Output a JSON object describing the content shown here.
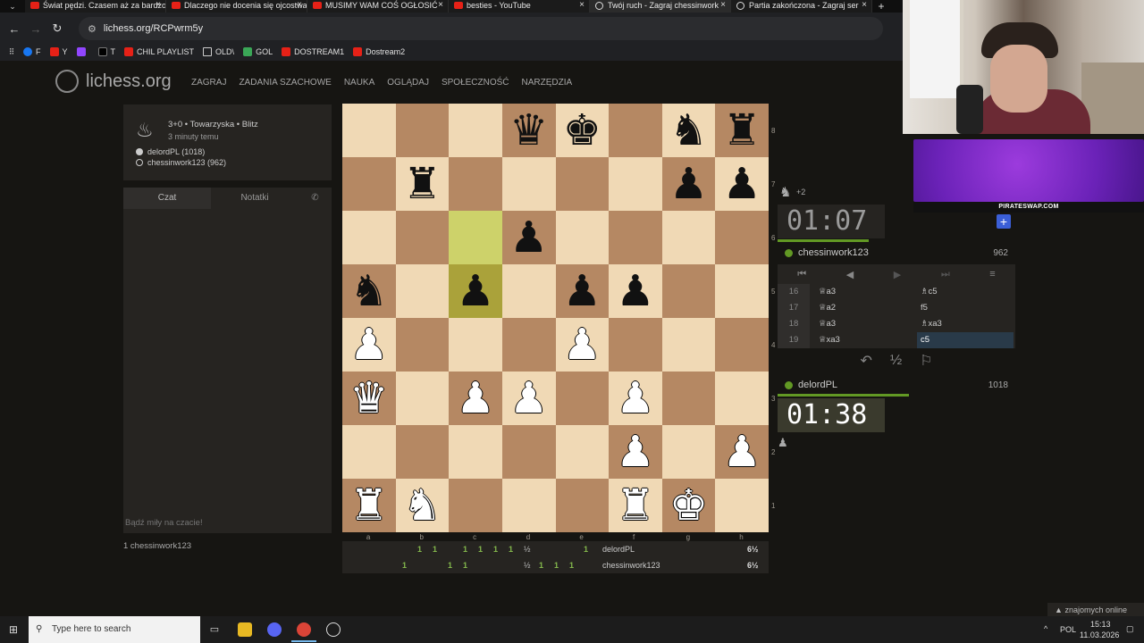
{
  "browser": {
    "tabs": [
      {
        "title": "Świat pędzi. Czasem aż za bardzo",
        "favicon": "youtube-icon",
        "active": false
      },
      {
        "title": "Dlaczego nie docenia się ojcostwa",
        "favicon": "youtube-icon",
        "active": false
      },
      {
        "title": "MUSIMY WAM COŚ OGŁOSIĆ",
        "favicon": "youtube-icon",
        "active": false
      },
      {
        "title": "besties - YouTube",
        "favicon": "youtube-icon",
        "active": false
      },
      {
        "title": "Twój ruch - Zagraj chessinwork",
        "favicon": "lichess-icon",
        "active": true
      },
      {
        "title": "Partia zakończona - Zagraj ser",
        "favicon": "lichess-icon",
        "active": false
      }
    ],
    "url": "lichess.org/RCPwrm5y",
    "bookmarks": [
      {
        "label": "F",
        "icon": "facebook-icon"
      },
      {
        "label": "Y",
        "icon": "youtube-icon"
      },
      {
        "label": "",
        "icon": "twitch-icon"
      },
      {
        "label": "T",
        "icon": "x-icon"
      },
      {
        "label": "CHIL PLAYLIST",
        "icon": "youtube-icon"
      },
      {
        "label": "OLD\\",
        "icon": "folder-icon"
      },
      {
        "label": "GOL",
        "icon": "gol-icon"
      },
      {
        "label": "DOSTREAM1",
        "icon": "youtube-icon"
      },
      {
        "label": "Dostream2",
        "icon": "youtube-icon"
      }
    ]
  },
  "site": {
    "logo": "lichess.org",
    "nav": [
      "ZAGRAJ",
      "ZADANIA SZACHOWE",
      "NAUKA",
      "OGLĄDAJ",
      "SPOŁECZNOŚĆ",
      "NARZĘDZIA"
    ]
  },
  "game": {
    "setup": "3+0 • Towarzyska • Blitz",
    "ago": "3 minuty temu",
    "white": "delordPL (1018)",
    "black": "chessinwork123 (962)"
  },
  "chat": {
    "tab_chat": "Czat",
    "tab_notes": "Notatki",
    "placeholder": "Bądź miły na czacie!",
    "spectators": "1  chessinwork123"
  },
  "board": {
    "orientation": "white",
    "highlight": [
      "c6",
      "c5"
    ],
    "pieces": {
      "d8": "q",
      "e8": "k",
      "g8": "n",
      "h8": "r",
      "b7": "r",
      "g7": "p",
      "h7": "p",
      "d6": "p",
      "a5": "n",
      "c5": "p",
      "e5": "p",
      "f5": "p",
      "a4": "P",
      "e4": "P",
      "a3": "Q",
      "c3": "P",
      "d3": "P",
      "f3": "P",
      "f2": "P",
      "h2": "P",
      "a1": "R",
      "b1": "N",
      "f1": "R",
      "g1": "K"
    },
    "files": [
      "a",
      "b",
      "c",
      "d",
      "e",
      "f",
      "g",
      "h"
    ],
    "ranks": [
      "8",
      "7",
      "6",
      "5",
      "4",
      "3",
      "2",
      "1"
    ]
  },
  "crosstable": {
    "rows": [
      {
        "name": "delordPL",
        "total": "6½",
        "scores": [
          "1",
          "1",
          "1",
          "1",
          "1",
          "1",
          "½",
          "1"
        ]
      },
      {
        "name": "chessinwork123",
        "total": "6½",
        "scores": [
          "1",
          "1",
          "1",
          "½",
          "1",
          "1",
          "1"
        ]
      }
    ]
  },
  "clocks": {
    "opponent_time": "01:07",
    "player_time": "01:38",
    "opponent_remaining": 0.34,
    "player_remaining": 0.5
  },
  "players": {
    "top": {
      "name": "chessinwork123",
      "rating": "962"
    },
    "bottom": {
      "name": "delordPL",
      "rating": "1018"
    },
    "material_diff": "+2"
  },
  "moves": [
    {
      "n": "16",
      "w": "♕a3",
      "b": "♗c5"
    },
    {
      "n": "17",
      "w": "♕a2",
      "b": "f5"
    },
    {
      "n": "18",
      "w": "♕a3",
      "b": "♗xa3"
    },
    {
      "n": "19",
      "w": "♕xa3",
      "b": "c5"
    }
  ],
  "actions": {
    "takeback": "↶",
    "draw": "½",
    "resign": "⚐"
  },
  "stream": {
    "banner_label": "PIRATESWAP.COM",
    "friends": "znajomych online"
  },
  "taskbar": {
    "search_placeholder": "Type here to search",
    "lang": "POL",
    "time": "15:13",
    "date": "11.03.2026"
  },
  "colors": {
    "light_square": "#f0d9b5",
    "dark_square": "#b58863",
    "online": "#629924",
    "win_score": "#84b84c"
  }
}
